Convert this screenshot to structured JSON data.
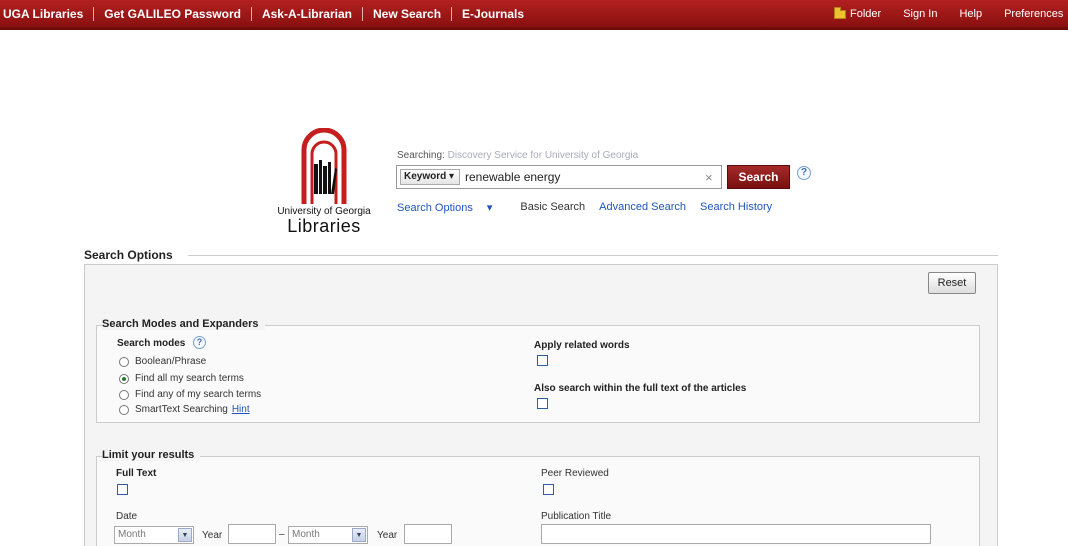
{
  "topbar": {
    "nav": [
      "UGA Libraries",
      "Get GALILEO Password",
      "Ask-A-Librarian",
      "New Search",
      "E-Journals"
    ],
    "folder": "Folder",
    "sign_in": "Sign In",
    "help": "Help",
    "preferences": "Preferences"
  },
  "logo": {
    "line1": "University of Georgia",
    "line2": "Libraries"
  },
  "search": {
    "searching_label": "Searching:",
    "scope": "Discovery Service for University of Georgia",
    "field": "Keyword",
    "query": "renewable energy",
    "button": "Search",
    "help": "?",
    "links": [
      "Search Options",
      "Basic Search",
      "Advanced Search",
      "Search History"
    ]
  },
  "options": {
    "title": "Search Options",
    "reset": "Reset",
    "modes_section": "Search Modes and Expanders",
    "modes_label": "Search modes",
    "modes": [
      {
        "label": "Boolean/Phrase",
        "selected": false
      },
      {
        "label": "Find all my search terms",
        "selected": true
      },
      {
        "label": "Find any of my search terms",
        "selected": false
      },
      {
        "label": "SmartText Searching",
        "selected": false
      }
    ],
    "hint": "Hint",
    "related_words": "Apply related words",
    "full_text_search": "Also search within the full text of the articles",
    "limit_section": "Limit your results",
    "full_text": "Full Text",
    "peer_reviewed": "Peer Reviewed",
    "date": "Date",
    "month_placeholder": "Month",
    "year_label": "Year",
    "dash": "–",
    "publication_title": "Publication Title"
  },
  "colors": {
    "topbar": "#8a1010",
    "search_button": "#7a1010",
    "link": "#2255bb"
  }
}
